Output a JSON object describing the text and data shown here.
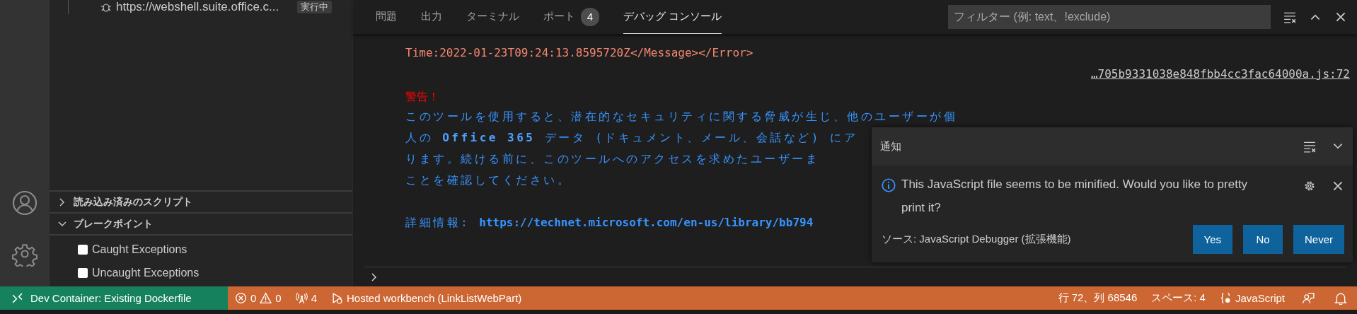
{
  "sidebar": {
    "session": {
      "label": "https://webshell.suite.office.c...",
      "badge": "実行中"
    },
    "sections": [
      {
        "title": "読み込み済みのスクリプト",
        "expanded": false
      },
      {
        "title": "ブレークポイント",
        "expanded": true,
        "breakpoints": [
          {
            "label": "Caught Exceptions",
            "checked": false
          },
          {
            "label": "Uncaught Exceptions",
            "checked": false
          }
        ]
      }
    ]
  },
  "panel": {
    "tabs": [
      {
        "label": "問題",
        "selected": false
      },
      {
        "label": "出力",
        "selected": false
      },
      {
        "label": "ターミナル",
        "selected": false
      },
      {
        "label": "ポート",
        "badge": "4",
        "selected": false
      },
      {
        "label": "デバッグ コンソール",
        "selected": true
      }
    ],
    "filter": {
      "placeholder": "フィルター (例: text、!exclude)"
    },
    "console": [
      {
        "kind": "error",
        "lines": [
          "Time:2022-01-23T09:24:13.8595720Z</Message></Error>"
        ]
      },
      {
        "kind": "source",
        "text": "…705b9331038e848fbb4cc3fac64000a.js:72"
      },
      {
        "kind": "warning",
        "title": "警告！",
        "lines": [
          "このツールを使用すると、潜在的なセキュリティに関する脅威が生じ、他のユーザーが個",
          "人の **Office 365** データ (ドキュメント、メール、会話など) にア",
          "ります。続ける前に、このツールへのアクセスを求めたユーザーま",
          "ことを確認してください。"
        ],
        "more_label": "詳細情報: ",
        "url": "https://technet.microsoft.com/en-us/library/bb794"
      }
    ]
  },
  "notification": {
    "title": "通知",
    "message": "This JavaScript file seems to be minified. Would you like to pretty print it?",
    "source": "ソース: JavaScript Debugger (拡張機能)",
    "buttons": [
      "Yes",
      "No",
      "Never"
    ]
  },
  "status_bar": {
    "remote": "Dev Container: Existing Dockerfile",
    "left": [
      {
        "kind": "problems",
        "errors": "0",
        "warnings": "0"
      },
      {
        "kind": "ports",
        "text": "4"
      },
      {
        "kind": "debug",
        "text": "Hosted workbench (LinkListWebPart)"
      }
    ],
    "right": [
      {
        "kind": "cursor",
        "text": "行 72、列 68546"
      },
      {
        "kind": "indent",
        "text": "スペース: 4"
      },
      {
        "kind": "language",
        "text": "JavaScript"
      },
      {
        "kind": "feedback"
      },
      {
        "kind": "bell"
      }
    ]
  }
}
